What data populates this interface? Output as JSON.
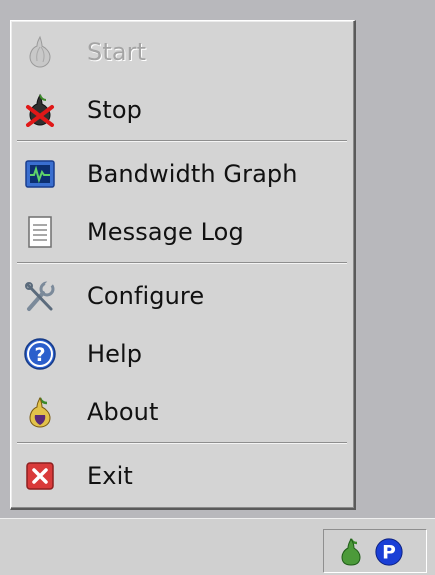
{
  "menu": {
    "items": [
      {
        "id": "start",
        "label": "Start",
        "icon": "onion-icon",
        "enabled": false
      },
      {
        "id": "stop",
        "label": "Stop",
        "icon": "onion-stop-icon",
        "enabled": true
      },
      {
        "id": "bandwidth",
        "label": "Bandwidth Graph",
        "icon": "graph-icon",
        "enabled": true
      },
      {
        "id": "log",
        "label": "Message Log",
        "icon": "document-icon",
        "enabled": true
      },
      {
        "id": "configure",
        "label": "Configure",
        "icon": "tools-icon",
        "enabled": true
      },
      {
        "id": "help",
        "label": "Help",
        "icon": "help-icon",
        "enabled": true
      },
      {
        "id": "about",
        "label": "About",
        "icon": "onion-icon",
        "enabled": true
      },
      {
        "id": "exit",
        "label": "Exit",
        "icon": "close-icon",
        "enabled": true
      }
    ]
  },
  "tray": {
    "icons": [
      "onion-icon",
      "parking-icon"
    ],
    "p_letter": "P"
  },
  "colors": {
    "menu_bg": "#d4d4d4",
    "desktop": "#b8b8bc",
    "taskbar": "#d0d0d0",
    "disabled_text": "#a4a4a4",
    "tray_blue": "#1a3fd6"
  }
}
